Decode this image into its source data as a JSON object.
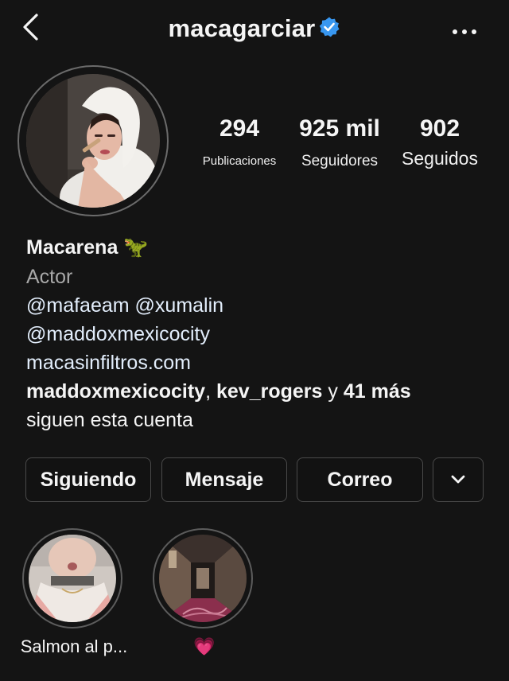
{
  "header": {
    "username": "macagarciar",
    "back_icon": "chevron-left-icon",
    "verified_icon": "verified-badge-icon",
    "more_icon": "more-horizontal-icon",
    "verified_color": "#3897f0"
  },
  "stats": [
    {
      "value": "294",
      "label": "Publicaciones"
    },
    {
      "value": "925 mil",
      "label": "Seguidores"
    },
    {
      "value": "902",
      "label": "Seguidos"
    }
  ],
  "bio": {
    "name": "Macarena",
    "name_emoji": "🦖",
    "category": "Actor",
    "lines": [
      "@mafaeam @xumalin",
      "@maddoxmexicocity",
      "macasinfiltros.com"
    ],
    "followed_by": {
      "user1": "maddoxmexicocity",
      "sep": ", ",
      "user2": "kev_rogers",
      "y": " y ",
      "more": "41 más",
      "suffix": "siguen esta cuenta"
    }
  },
  "buttons": {
    "following": "Siguiendo",
    "message": "Mensaje",
    "email": "Correo",
    "dropdown_icon": "chevron-down-icon"
  },
  "highlights": [
    {
      "label": "Salmon al p..."
    },
    {
      "label": "💗"
    }
  ],
  "colors": {
    "background": "#141414",
    "secondary_text": "#a8a8a8",
    "link_text": "#e3eefc",
    "button_border": "#4a4a4a"
  }
}
